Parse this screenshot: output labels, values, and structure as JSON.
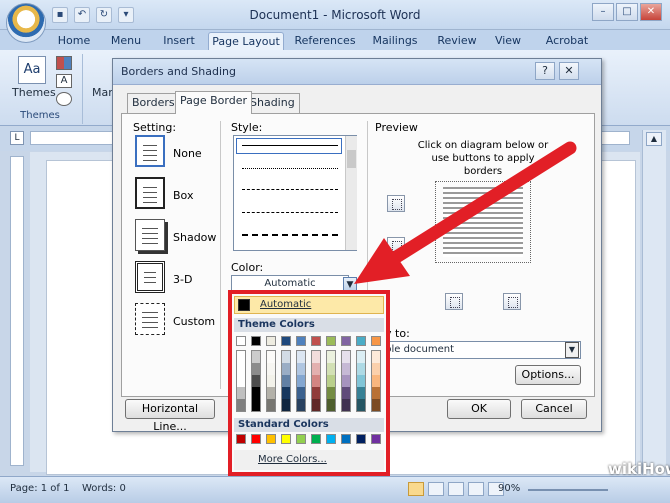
{
  "window": {
    "title": "Document1 - Microsoft Word",
    "min": "–",
    "max": "□",
    "close": "✕"
  },
  "qat": {
    "save": "▪",
    "undo": "↶",
    "redo": "↻",
    "paint": "▾"
  },
  "ribbon": {
    "tabs": [
      "Home",
      "Menu",
      "Insert",
      "Page Layout",
      "References",
      "Mailings",
      "Review",
      "View",
      "Acrobat"
    ],
    "active_tab": "Page Layout",
    "themes_button": "Themes",
    "themes_group": "Themes",
    "margins_button": "Marg"
  },
  "dialog": {
    "title": "Borders and Shading",
    "help": "?",
    "close": "✕",
    "tabs": [
      "Borders",
      "Page Border",
      "Shading"
    ],
    "setting_label": "Setting:",
    "settings": [
      "None",
      "Box",
      "Shadow",
      "3-D",
      "Custom"
    ],
    "style_label": "Style:",
    "color_label": "Color:",
    "color_value": "Automatic",
    "preview_label": "Preview",
    "preview_hint": "Click on diagram below or use buttons to apply borders",
    "apply_to_label": "ply to:",
    "apply_to_value": "hole document",
    "horizontal_line": "Horizontal Line...",
    "options": "Options...",
    "ok": "OK",
    "cancel": "Cancel"
  },
  "color_popup": {
    "automatic": "Automatic",
    "theme_colors": "Theme Colors",
    "standard_colors": "Standard Colors",
    "more_colors": "More Colors...",
    "theme_row": [
      "#ffffff",
      "#000000",
      "#eeece1",
      "#1f497d",
      "#4f81bd",
      "#c0504d",
      "#9bbb59",
      "#8064a2",
      "#4bacc6",
      "#f79646"
    ],
    "standard_row": [
      "#c00000",
      "#ff0000",
      "#ffc000",
      "#ffff00",
      "#92d050",
      "#00b050",
      "#00b0f0",
      "#0070c0",
      "#002060",
      "#7030a0"
    ]
  },
  "status": {
    "page": "Page: 1 of 1",
    "words": "Words: 0",
    "zoom": "90%"
  },
  "watermark": "wikiHow",
  "colors": {
    "arrow": "#e21f26",
    "highlight": "#e21f26"
  }
}
